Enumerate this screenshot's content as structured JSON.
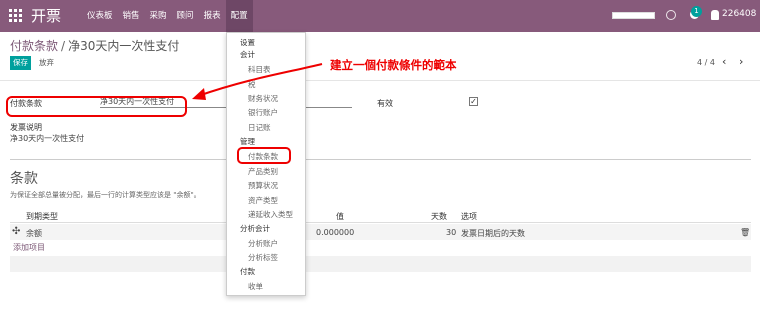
{
  "topbar": {
    "app_title": "开票",
    "menu": [
      "仪表板",
      "销售",
      "采购",
      "顾问",
      "报表",
      "配置"
    ],
    "active_menu": "配置",
    "badge_count": "1",
    "user": "226408",
    "color": "#875a7b"
  },
  "breadcrumb": {
    "parent": "付款条款",
    "sep": "/",
    "current": "净30天内一次性支付"
  },
  "actions": {
    "save": "保存",
    "discard": "放弃"
  },
  "pager": {
    "text": "4 / 4",
    "prev": "‹",
    "next": "›"
  },
  "form": {
    "name_label": "付款条款",
    "name_value": "净30天内一次性支付",
    "active_label": "有效",
    "active_checked": "✓",
    "desc_label": "发票说明",
    "desc_value": "净30天内一次性支付"
  },
  "terms": {
    "title": "条款",
    "help": "为保证全部总量被分配，最后一行的计算类型应该是 \"余额\"。",
    "columns": {
      "type": "到期类型",
      "value": "值",
      "days": "天数",
      "option": "选项"
    },
    "rows": [
      {
        "type": "余额",
        "value": "0.000000",
        "days": "30",
        "option": "发票日期后的天数"
      }
    ],
    "add_line": "添加项目"
  },
  "dropdown": {
    "items": [
      {
        "label": "设置",
        "level": 0
      },
      {
        "label": "会计",
        "level": 0
      },
      {
        "label": "科目表",
        "level": 1
      },
      {
        "label": "税",
        "level": 1
      },
      {
        "label": "财务状况",
        "level": 1
      },
      {
        "label": "银行账户",
        "level": 1
      },
      {
        "label": "日记账",
        "level": 1
      },
      {
        "label": "管理",
        "level": 0
      },
      {
        "label": "付款条款",
        "level": 1
      },
      {
        "label": "产品类别",
        "level": 1
      },
      {
        "label": "预算状况",
        "level": 1
      },
      {
        "label": "资产类型",
        "level": 1
      },
      {
        "label": "递延收入类型",
        "level": 1
      },
      {
        "label": "分析会计",
        "level": 0
      },
      {
        "label": "分析账户",
        "level": 1
      },
      {
        "label": "分析标签",
        "level": 1
      },
      {
        "label": "付款",
        "level": 0
      },
      {
        "label": "收单",
        "level": 1
      }
    ]
  },
  "annotation": {
    "text": "建立一個付款條件的範本",
    "color": "#e00000"
  },
  "icons": {
    "apps": "apps-grid-icon",
    "clock": "clock-icon",
    "chat": "chat-icon",
    "user": "user-icon",
    "drag": "drag-handle-icon",
    "trash": "trash-icon"
  }
}
